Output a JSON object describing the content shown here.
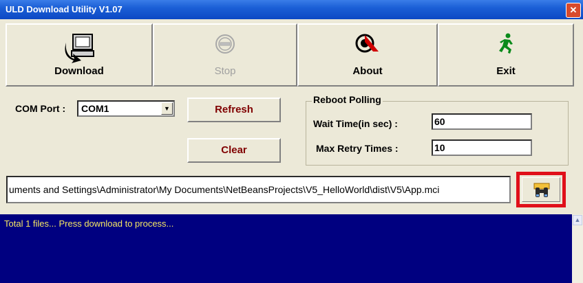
{
  "window": {
    "title": "ULD Download Utility  V1.07",
    "close_symbol": "✕"
  },
  "toolbar": {
    "download_label": "Download",
    "stop_label": "Stop",
    "about_label": "About",
    "exit_label": "Exit"
  },
  "com": {
    "label": "COM Port :",
    "value": "COM1"
  },
  "buttons": {
    "refresh_label": "Refresh",
    "clear_label": "Clear"
  },
  "reboot": {
    "legend": "Reboot Polling",
    "wait_label": "Wait Time(in sec) :",
    "wait_value": "60",
    "retry_label": "Max Retry Times :",
    "retry_value": "10"
  },
  "path": {
    "value": "uments and Settings\\Administrator\\My Documents\\NetBeansProjects\\V5_HelloWorld\\dist\\V5\\App.mci"
  },
  "log": {
    "lines": [
      "Total 1 files... Press download to process..."
    ]
  },
  "colors": {
    "log_bg": "#000080",
    "log_text": "#f5e663",
    "highlight": "#e0101a"
  }
}
